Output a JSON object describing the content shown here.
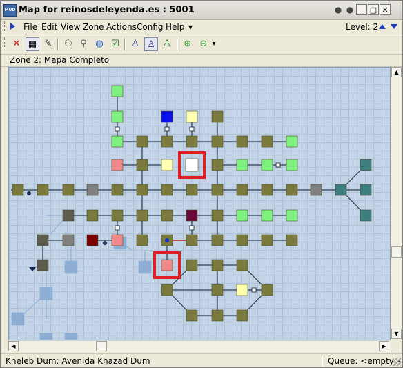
{
  "window": {
    "title": "Map for reinosdeleyenda.es : 5001",
    "app_icon_text": "MUD"
  },
  "title_buttons": [
    {
      "name": "status-icon",
      "glyph": "●"
    },
    {
      "name": "help-icon",
      "glyph": "●"
    },
    {
      "name": "minimize-button",
      "glyph": "_"
    },
    {
      "name": "maximize-button",
      "glyph": "□"
    },
    {
      "name": "close-button",
      "glyph": "✕"
    }
  ],
  "menu": {
    "items": [
      "File",
      "Edit",
      "View",
      "Zone",
      "Actions",
      "Config",
      "Help",
      "▾"
    ],
    "level_label": "Level: 2"
  },
  "toolbar": {
    "tools": [
      {
        "name": "delete-icon",
        "glyph": "✕",
        "color": "#d01010",
        "pressed": false
      },
      {
        "name": "grid-icon",
        "glyph": "▦",
        "color": "#000000",
        "pressed": true
      },
      {
        "name": "wand-icon",
        "glyph": "✎",
        "color": "#333333",
        "pressed": false
      },
      {
        "name": "binoculars-icon",
        "glyph": "⚇",
        "color": "#444444",
        "pressed": false
      },
      {
        "name": "magnifier-icon",
        "glyph": "⚲",
        "color": "#555555",
        "pressed": false
      },
      {
        "name": "globe-icon",
        "glyph": "◍",
        "color": "#1f5bbf",
        "pressed": false
      },
      {
        "name": "check-icon",
        "glyph": "☑",
        "color": "#1d6b25",
        "pressed": false
      },
      {
        "name": "walker-list-icon",
        "glyph": "♙",
        "color": "#2b3a8a",
        "pressed": false
      },
      {
        "name": "walker-path-icon",
        "glyph": "♙",
        "color": "#2b3a8a",
        "pressed": true
      },
      {
        "name": "walker-icon",
        "glyph": "♙",
        "color": "#1d6b25",
        "pressed": false
      },
      {
        "name": "zoom-in-icon",
        "glyph": "⊕",
        "color": "#2a8a2a",
        "pressed": false
      },
      {
        "name": "zoom-out-icon",
        "glyph": "⊖",
        "color": "#2a8a2a",
        "pressed": false
      },
      {
        "name": "dropdown-icon",
        "glyph": "▾",
        "color": "#000000",
        "pressed": false
      }
    ]
  },
  "zone": {
    "label": "Zone 2: Mapa Completo"
  },
  "status": {
    "location": "Kheleb Dum: Avenida Khazad Dum",
    "queue": "Queue: <empty>"
  },
  "colors": {
    "room": "#7a7a3e",
    "room_green": "#7ef07e",
    "room_pink": "#f08a8a",
    "room_yellow": "#ffffb0",
    "room_blue": "#0a10f0",
    "room_white": "#ffffff",
    "room_gray": "#808080",
    "room_teal": "#3d7e80",
    "room_maroon": "#6a0a3a",
    "room_darkred": "#7a0000",
    "room_darkgray": "#5c5c50",
    "room_faded": "#8eadd2",
    "highlight": "#e02020",
    "link": "#2d3f4f"
  }
}
